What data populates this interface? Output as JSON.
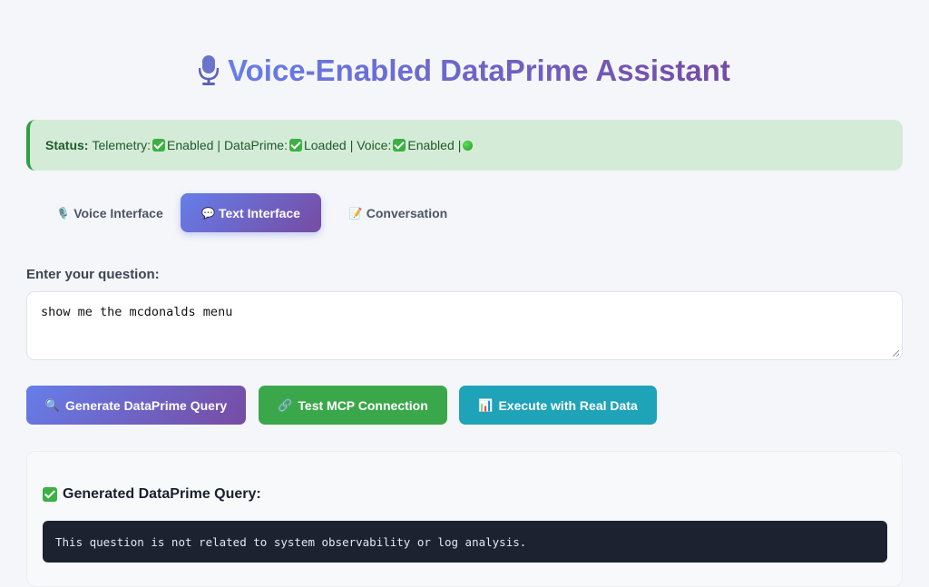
{
  "header": {
    "title": "Voice-Enabled DataPrime Assistant",
    "icon": "microphone-icon",
    "gradient": [
      "#667eea",
      "#764ba2"
    ]
  },
  "status": {
    "label": "Status:",
    "telemetry_label": "Telemetry:",
    "telemetry_value": "Enabled",
    "dataprime_label": "| DataPrime:",
    "dataprime_value": "Loaded",
    "voice_label": "| Voice:",
    "voice_value": "Enabled",
    "trailing_separator": "|",
    "background": "#d4ecd7",
    "accent": "#2f9e44"
  },
  "tabs": [
    {
      "label": "Voice Interface",
      "icon": "microphone-icon",
      "icon_glyph": "🎙️",
      "active": false
    },
    {
      "label": "Text Interface",
      "icon": "speech-bubble-icon",
      "icon_glyph": "💬",
      "active": true
    },
    {
      "label": "Conversation",
      "icon": "memo-icon",
      "icon_glyph": "📝",
      "active": false
    }
  ],
  "question": {
    "label": "Enter your question:",
    "value": "show me the mcdonalds menu"
  },
  "actions": [
    {
      "label": "Generate DataPrime Query",
      "icon": "magnifier-icon",
      "icon_glyph": "🔍",
      "color": "#667eea"
    },
    {
      "label": "Test MCP Connection",
      "icon": "link-icon",
      "icon_glyph": "🔗",
      "color": "#3aa84a"
    },
    {
      "label": "Execute with Real Data",
      "icon": "bar-chart-icon",
      "icon_glyph": "📊",
      "color": "#1fa3b8"
    }
  ],
  "result": {
    "title": "Generated DataPrime Query:",
    "code": "This question is not related to system observability or log analysis."
  }
}
